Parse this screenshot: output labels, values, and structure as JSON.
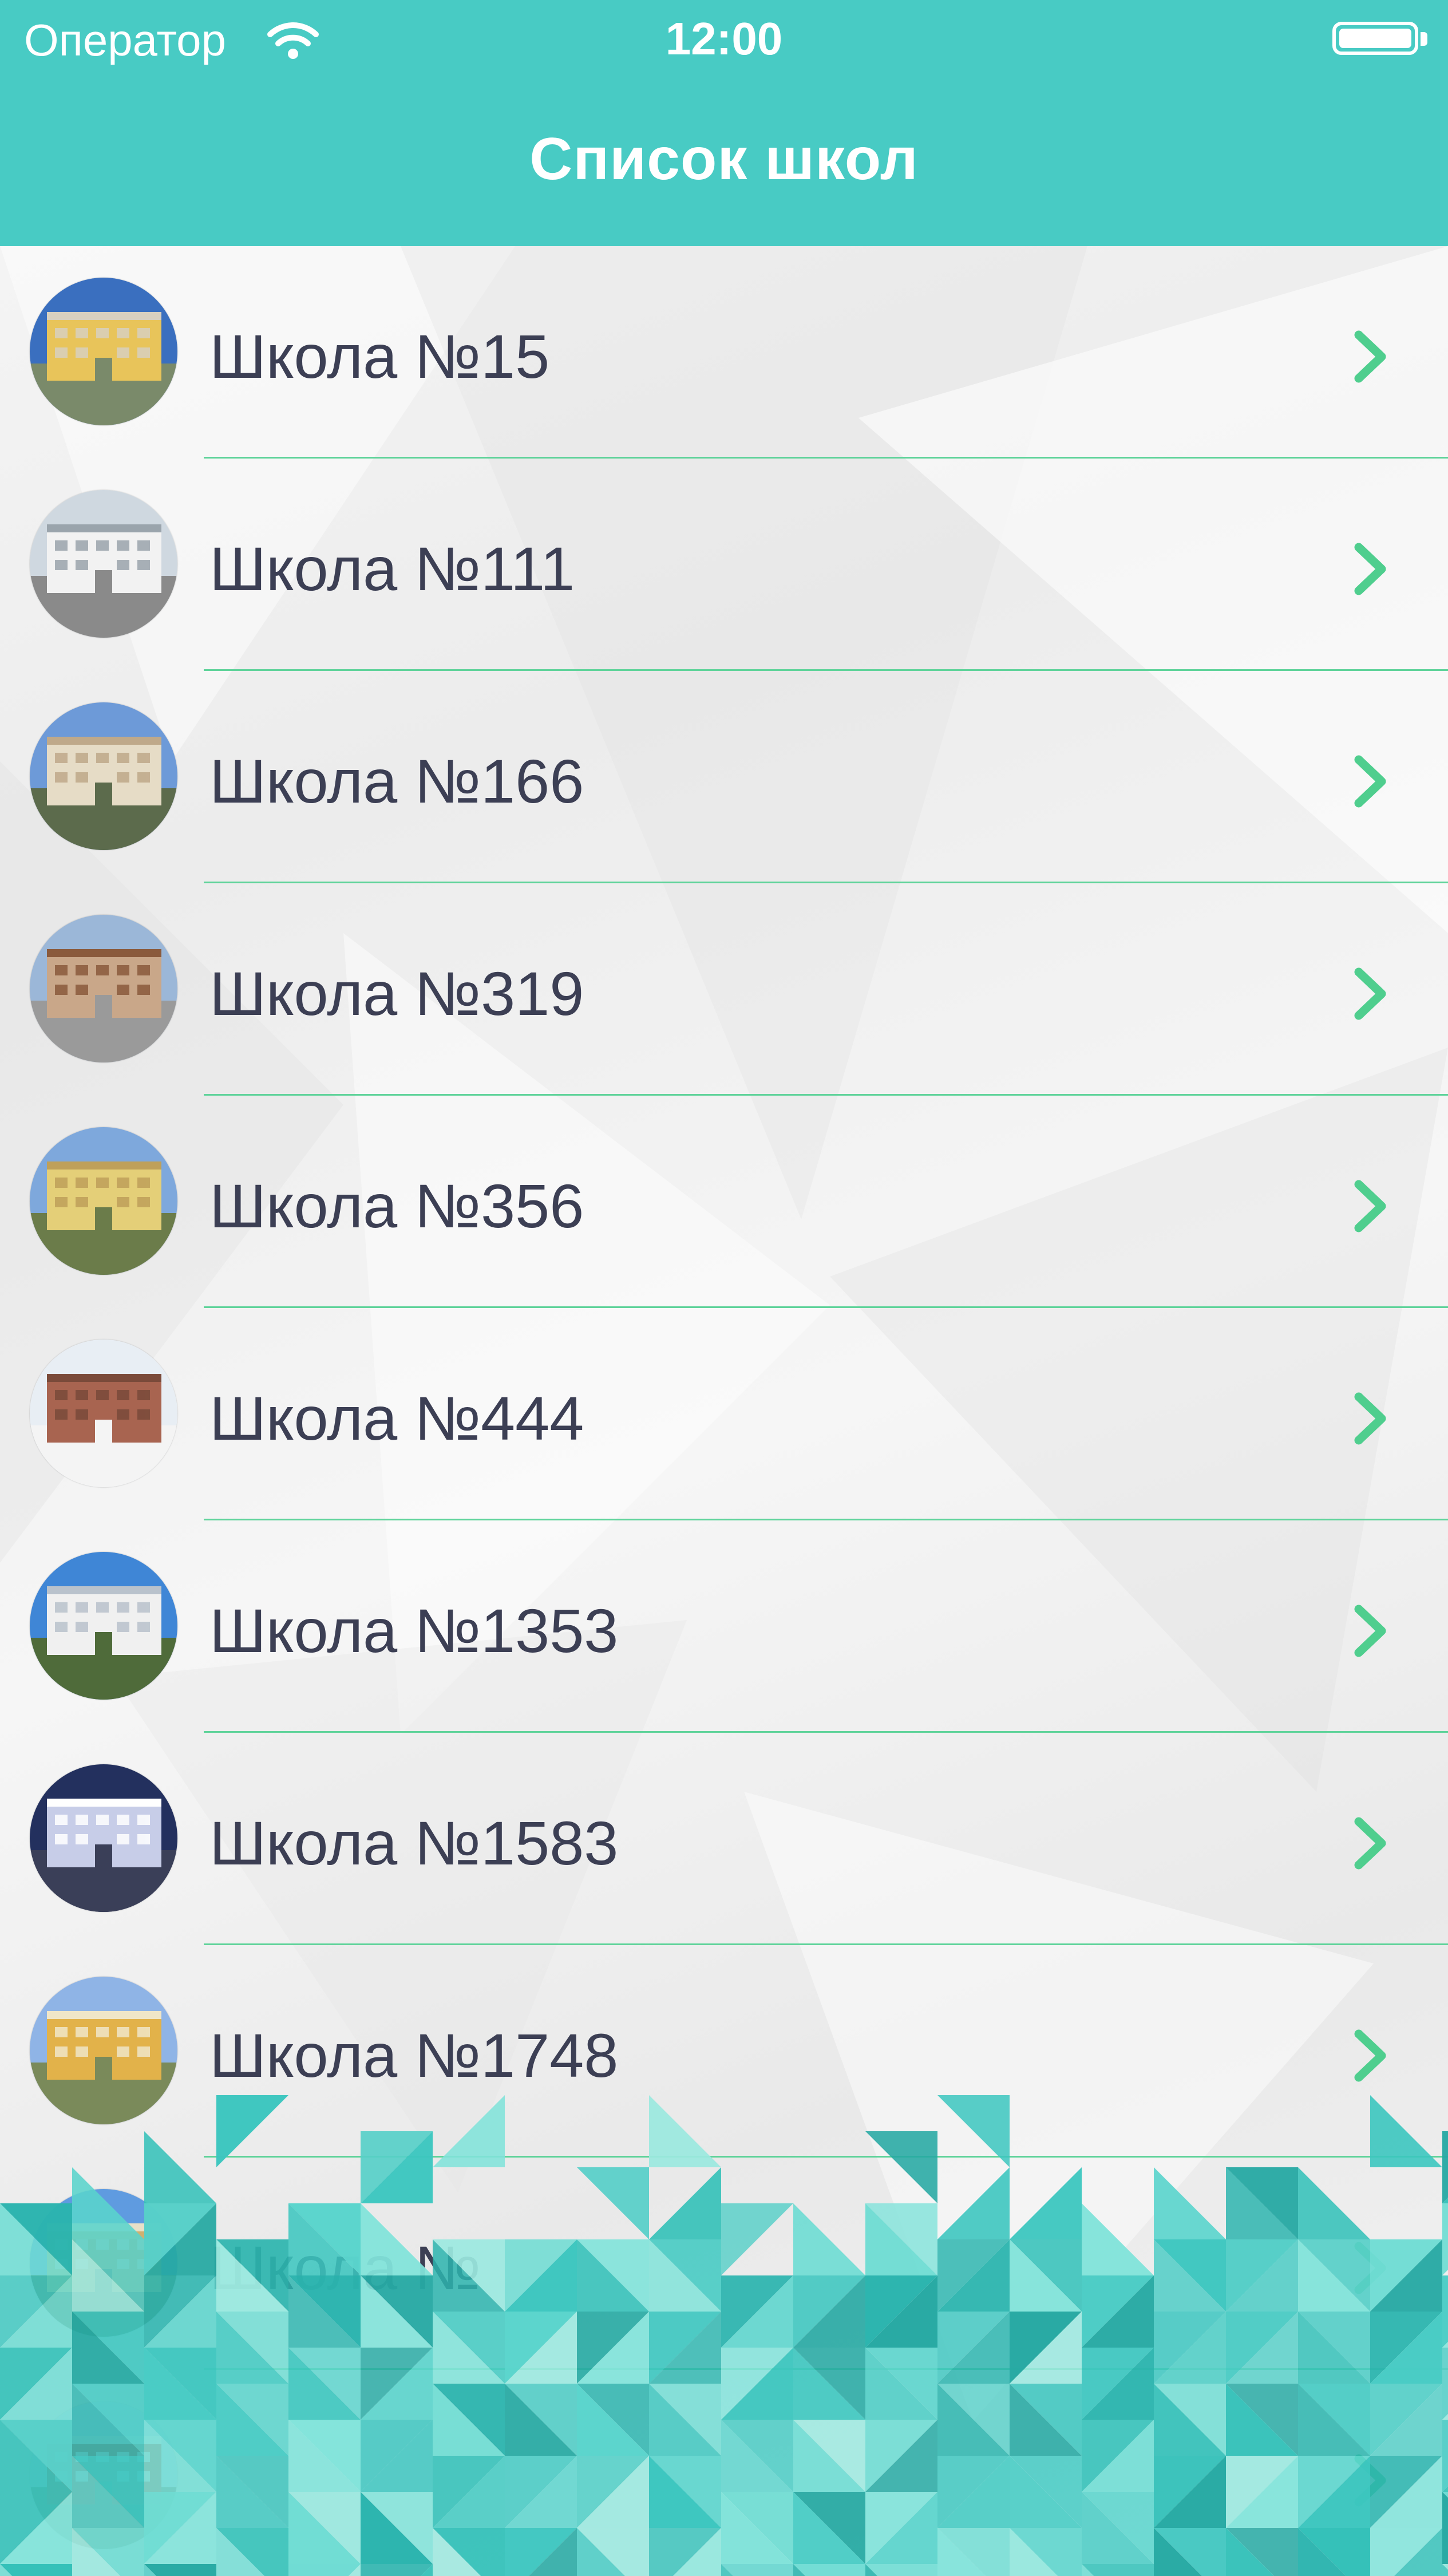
{
  "status_bar": {
    "carrier": "Оператор",
    "time": "12:00"
  },
  "header": {
    "title": "Список школ"
  },
  "schools": [
    {
      "name": "Школа №15"
    },
    {
      "name": "Школа №111"
    },
    {
      "name": "Школа №166"
    },
    {
      "name": "Школа №319"
    },
    {
      "name": "Школа №356"
    },
    {
      "name": "Школа №444"
    },
    {
      "name": "Школа №1353"
    },
    {
      "name": "Школа №1583"
    },
    {
      "name": "Школа №1748"
    },
    {
      "name": "Школа №"
    },
    {
      "name": ""
    }
  ],
  "colors": {
    "header": "#48cbc4",
    "accent": "#4fce8e",
    "text": "#3c3f54"
  },
  "icons": [
    "wifi-icon",
    "battery-icon",
    "chevron-right-icon",
    "school-photo"
  ]
}
